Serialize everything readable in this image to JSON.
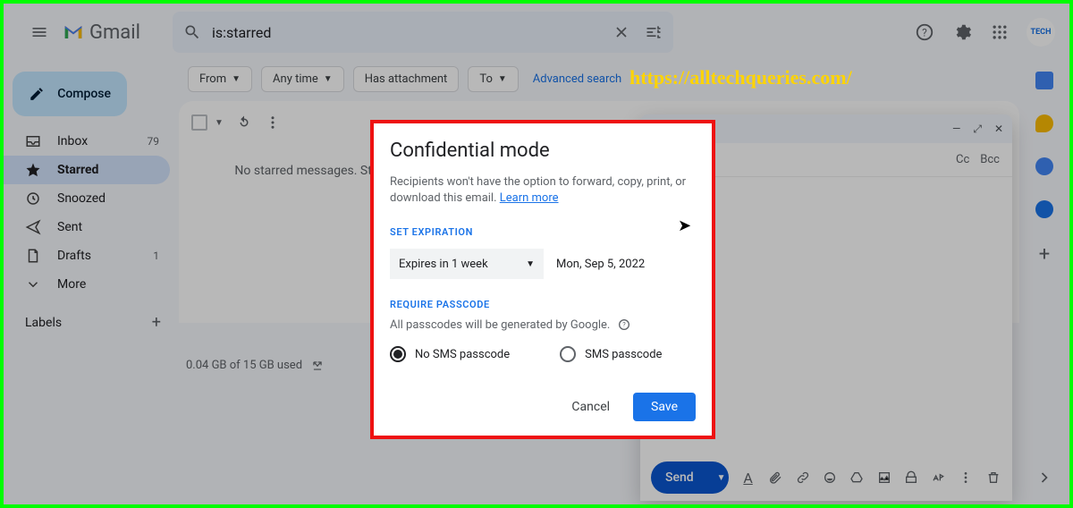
{
  "header": {
    "product": "Gmail",
    "search_value": "is:starred"
  },
  "watermark": "https://alltechqueries.com/",
  "sidebar": {
    "compose": "Compose",
    "items": [
      {
        "label": "Inbox",
        "count": "79"
      },
      {
        "label": "Starred",
        "count": ""
      },
      {
        "label": "Snoozed",
        "count": ""
      },
      {
        "label": "Sent",
        "count": ""
      },
      {
        "label": "Drafts",
        "count": "1"
      },
      {
        "label": "More",
        "count": ""
      }
    ],
    "labels_heading": "Labels"
  },
  "filters": {
    "from": "From",
    "anytime": "Any time",
    "has_attachment": "Has attachment",
    "to": "To",
    "advanced": "Advanced search"
  },
  "mainline": "No starred messages. Stars let you give messages a special status to make them easier to find. To star a message, click on the star outline beside any message or conversation.",
  "storage": "0.04 GB of 15 GB used",
  "compose_window": {
    "cc": "Cc",
    "bcc": "Bcc",
    "send": "Send"
  },
  "modal": {
    "title": "Confidential mode",
    "desc": "Recipients won't have the option to forward, copy, print, or download this email. ",
    "learn": "Learn more",
    "set_expiration": "SET EXPIRATION",
    "expires_label": "Expires in 1 week",
    "expires_date": "Mon, Sep 5, 2022",
    "require_passcode": "REQUIRE PASSCODE",
    "passcode_note": "All passcodes will be generated by Google.",
    "opt_no_sms": "No SMS passcode",
    "opt_sms": "SMS passcode",
    "cancel": "Cancel",
    "save": "Save"
  }
}
